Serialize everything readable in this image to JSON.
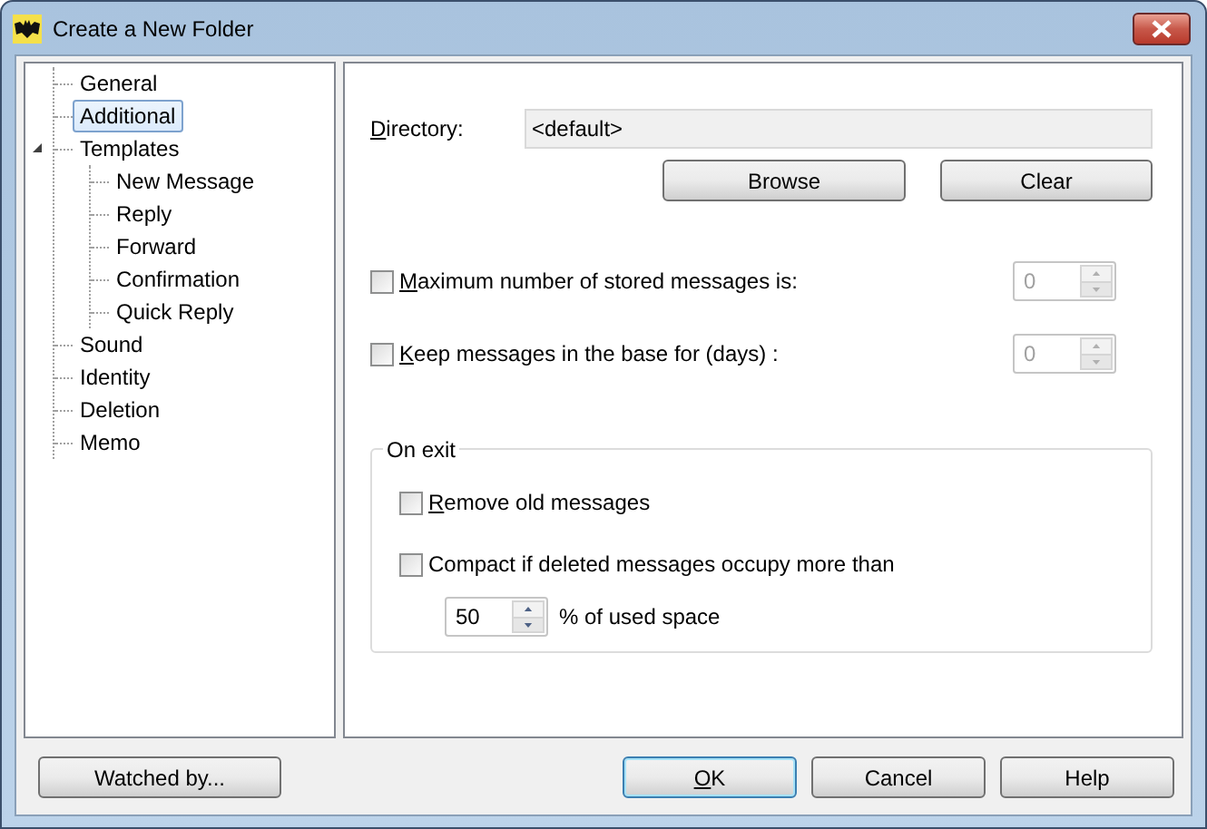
{
  "window": {
    "title": "Create a New Folder"
  },
  "tree": [
    {
      "label": "General",
      "selected": false
    },
    {
      "label": "Additional",
      "selected": true
    },
    {
      "label": "Templates",
      "selected": false,
      "expanded": true,
      "children": [
        {
          "label": "New Message",
          "selected": false
        },
        {
          "label": "Reply",
          "selected": false
        },
        {
          "label": "Forward",
          "selected": false
        },
        {
          "label": "Confirmation",
          "selected": false
        },
        {
          "label": "Quick Reply",
          "selected": false
        }
      ]
    },
    {
      "label": "Sound",
      "selected": false
    },
    {
      "label": "Identity",
      "selected": false
    },
    {
      "label": "Deletion",
      "selected": false
    },
    {
      "label": "Memo",
      "selected": false
    }
  ],
  "directory": {
    "label": "Directory:",
    "underline_first": true,
    "value": "<default>",
    "buttons": [
      "Browse",
      "Clear"
    ]
  },
  "limits": [
    {
      "label": "Maximum number of stored messages is:",
      "underline_first": true,
      "checked": false,
      "value": "0",
      "disabled": true
    },
    {
      "label": "Keep messages in the base for (days) :",
      "underline_first": true,
      "checked": false,
      "value": "0",
      "disabled": true
    }
  ],
  "on_exit": {
    "title": "On exit",
    "options": [
      {
        "label": "Remove old messages",
        "underline_first": true,
        "checked": false
      },
      {
        "label": "Compact if deleted messages occupy more than",
        "underline_first": false,
        "checked": false
      }
    ],
    "percent": {
      "value": "50",
      "suffix": "% of used space",
      "disabled": false
    }
  },
  "watched_button": "Watched by...",
  "footer_buttons": [
    {
      "label": "OK",
      "default": true,
      "underline_first": true
    },
    {
      "label": "Cancel",
      "default": false,
      "underline_first": false
    },
    {
      "label": "Help",
      "default": false,
      "underline_first": false
    }
  ]
}
